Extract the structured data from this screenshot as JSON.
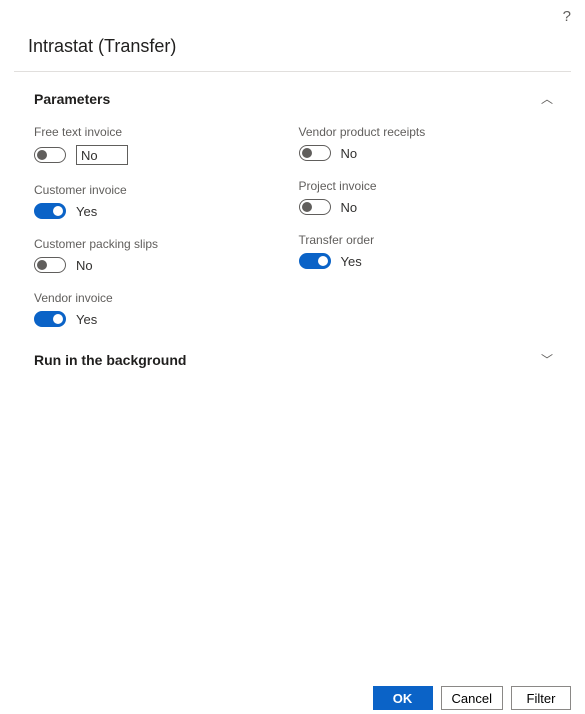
{
  "dialog": {
    "title": "Intrastat (Transfer)",
    "help_tooltip": "?"
  },
  "sections": {
    "parameters": {
      "title": "Parameters",
      "expanded": true
    },
    "run_in_background": {
      "title": "Run in the background",
      "expanded": false
    }
  },
  "fields": {
    "free_text_invoice": {
      "label": "Free text invoice",
      "value": "No",
      "on": false
    },
    "customer_invoice": {
      "label": "Customer invoice",
      "value": "Yes",
      "on": true
    },
    "customer_packing_slips": {
      "label": "Customer packing slips",
      "value": "No",
      "on": false
    },
    "vendor_invoice": {
      "label": "Vendor invoice",
      "value": "Yes",
      "on": true
    },
    "vendor_product_receipts": {
      "label": "Vendor product receipts",
      "value": "No",
      "on": false
    },
    "project_invoice": {
      "label": "Project invoice",
      "value": "No",
      "on": false
    },
    "transfer_order": {
      "label": "Transfer order",
      "value": "Yes",
      "on": true
    }
  },
  "buttons": {
    "ok": "OK",
    "cancel": "Cancel",
    "filter": "Filter"
  }
}
